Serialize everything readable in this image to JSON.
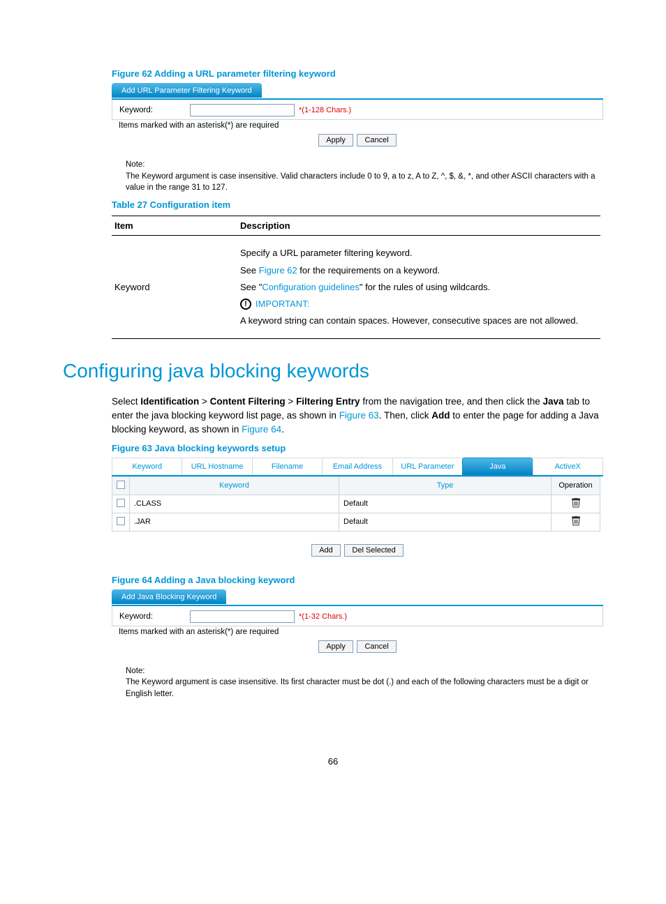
{
  "figure62": {
    "caption": "Figure 62 Adding a URL parameter filtering keyword",
    "tab_title": "Add URL Parameter Filtering Keyword",
    "label": "Keyword:",
    "hint": "*(1-128 Chars.)",
    "required_note": "Items marked with an asterisk(*) are required",
    "apply": "Apply",
    "cancel": "Cancel",
    "note_head": "Note:",
    "note_body": "The Keyword argument is case insensitive. Valid characters include 0 to 9, a to z, A to Z, ^, $, &, *, and other ASCII characters with a value in the range 31 to 127."
  },
  "table27": {
    "caption": "Table 27 Configuration item",
    "head_item": "Item",
    "head_desc": "Description",
    "row_item": "Keyword",
    "desc1": "Specify a URL parameter filtering keyword.",
    "desc2a": "See ",
    "desc2b": "Figure 62",
    "desc2c": " for the requirements on a keyword.",
    "desc3a": "See \"",
    "desc3b": "Configuration guidelines",
    "desc3c": "\" for the rules of using wildcards.",
    "important": "IMPORTANT:",
    "desc4": "A keyword string can contain spaces. However, consecutive spaces are not allowed."
  },
  "section_heading": "Configuring java blocking keywords",
  "nav_text": {
    "p1a": "Select ",
    "p1b": "Identification",
    "p1c": " > ",
    "p1d": "Content Filtering",
    "p1e": " > ",
    "p1f": "Filtering Entry",
    "p1g": " from the navigation tree, and then click the ",
    "p1h": "Java",
    "p1i": " tab to enter the java blocking keyword list page, as shown in ",
    "p1j": "Figure 63",
    "p1k": ". Then, click ",
    "p1l": "Add",
    "p1m": " to enter the page for adding a Java blocking keyword, as shown in ",
    "p1n": "Figure 64",
    "p1o": "."
  },
  "figure63": {
    "caption": "Figure 63 Java blocking keywords setup",
    "tabs": [
      "Keyword",
      "URL Hostname",
      "Filename",
      "Email Address",
      "URL Parameter",
      "Java",
      "ActiveX"
    ],
    "active_tab_index": 5,
    "col_keyword": "Keyword",
    "col_type": "Type",
    "col_operation": "Operation",
    "rows": [
      {
        "keyword": ".CLASS",
        "type": "Default"
      },
      {
        "keyword": ".JAR",
        "type": "Default"
      }
    ],
    "btn_add": "Add",
    "btn_del": "Del Selected"
  },
  "figure64": {
    "caption": "Figure 64 Adding a Java blocking keyword",
    "tab_title": "Add Java Blocking Keyword",
    "label": "Keyword:",
    "hint": "*(1-32 Chars.)",
    "required_note": "Items marked with an asterisk(*) are required",
    "apply": "Apply",
    "cancel": "Cancel",
    "note_head": "Note:",
    "note_body": "The Keyword argument is case insensitive. Its first character must be dot (.) and each of the following characters must be a digit or English letter."
  },
  "page_number": "66"
}
